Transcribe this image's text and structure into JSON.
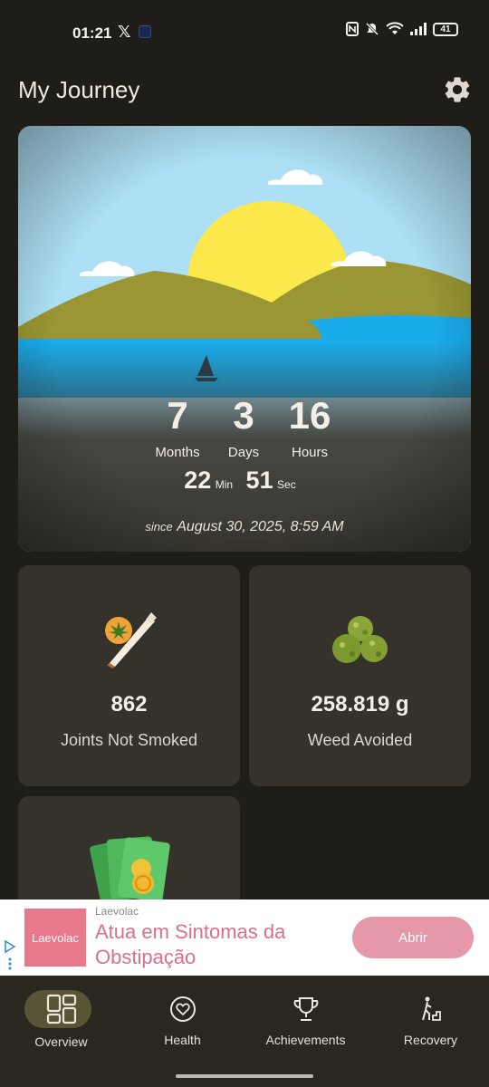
{
  "status_bar": {
    "time": "01:21",
    "x_glyph": "𝕏",
    "battery": "41",
    "icons": [
      "nfc-icon",
      "mute-icon",
      "wifi-icon",
      "signal-icon",
      "battery-icon"
    ]
  },
  "header": {
    "title": "My Journey",
    "settings_icon": "gear-icon"
  },
  "hero": {
    "months": "7",
    "months_label": "Months",
    "days": "3",
    "days_label": "Days",
    "hours": "16",
    "hours_label": "Hours",
    "minutes": "22",
    "minutes_label": "Min",
    "seconds": "51",
    "seconds_label": "Sec",
    "since_word": "since",
    "since_date": "August 30, 2025, 8:59 AM"
  },
  "stats": [
    {
      "value": "862",
      "label": "Joints Not Smoked",
      "icon": "joint-icon"
    },
    {
      "value": "258.819 g",
      "label": "Weed Avoided",
      "icon": "weed-buds-icon"
    },
    {
      "value": "",
      "label": "",
      "icon": "money-icon"
    }
  ],
  "ad": {
    "logo_text": "Laevolac",
    "brand": "Laevolac",
    "headline": "Atua em Sintomas da Obstipação",
    "cta": "Abrir",
    "colors": {
      "accent": "#e8798d",
      "cta": "#e498a8",
      "headline": "#d9708a"
    }
  },
  "nav": {
    "items": [
      {
        "label": "Overview",
        "icon": "overview-icon",
        "active": true
      },
      {
        "label": "Health",
        "icon": "heart-icon",
        "active": false
      },
      {
        "label": "Achievements",
        "icon": "trophy-icon",
        "active": false
      },
      {
        "label": "Recovery",
        "icon": "recovery-icon",
        "active": false
      }
    ]
  },
  "colors": {
    "background": "#1f1d17",
    "card": "#35322b",
    "nav_active_pill": "#5a5436",
    "sky": "#aee0f5",
    "sun": "#fbe84b",
    "hills": "#9a9634",
    "water": "#1aabeb"
  }
}
